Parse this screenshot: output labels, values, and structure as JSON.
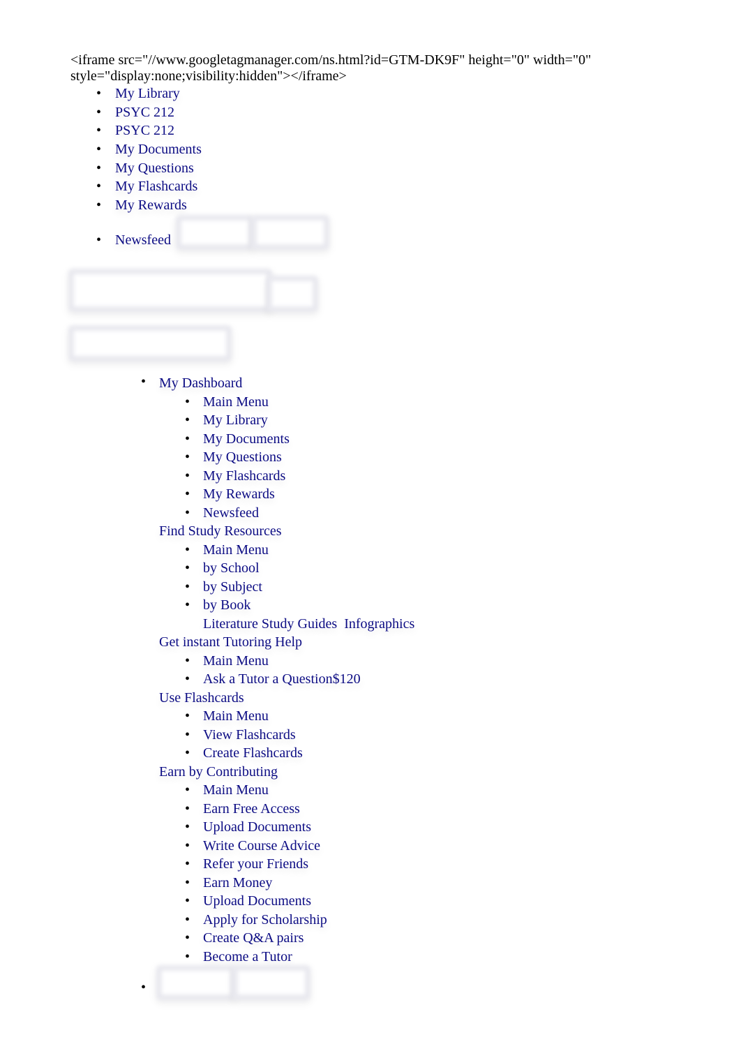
{
  "noscript_text": "<iframe src=\"//www.googletagmanager.com/ns.html?id=GTM-DK9F\" height=\"0\" width=\"0\" style=\"display:none;visibility:hidden\"></iframe>",
  "top_nav": {
    "items": [
      {
        "label": "My Library"
      },
      {
        "label": "PSYC 212"
      },
      {
        "label": "PSYC 212"
      },
      {
        "label": "My Documents"
      },
      {
        "label": "My Questions"
      },
      {
        "label": "My Flashcards"
      },
      {
        "label": "My Rewards"
      }
    ],
    "newsfeed_label": "Newsfeed"
  },
  "main_nav": {
    "dashboard": {
      "label": "My Dashboard",
      "items": [
        {
          "label": "Main Menu"
        },
        {
          "label": "My Library"
        },
        {
          "label": "My Documents"
        },
        {
          "label": "My Questions"
        },
        {
          "label": "My Flashcards"
        },
        {
          "label": "My Rewards"
        },
        {
          "label": "Newsfeed"
        }
      ]
    },
    "study_resources": {
      "label": "Find Study Resources",
      "items": [
        {
          "label": "Main Menu"
        },
        {
          "label": "by School"
        },
        {
          "label": "by Subject"
        },
        {
          "label": "by Book"
        }
      ],
      "extra_links": [
        "Literature Study Guides",
        "Infographics"
      ]
    },
    "tutoring": {
      "label": "Get instant Tutoring Help",
      "items": [
        {
          "label": "Main Menu"
        },
        {
          "label": "Ask a Tutor a Question$120"
        }
      ]
    },
    "flashcards": {
      "label": "Use Flashcards",
      "items": [
        {
          "label": "Main Menu"
        },
        {
          "label": "View Flashcards"
        },
        {
          "label": "Create Flashcards"
        }
      ]
    },
    "contributing": {
      "label": "Earn by Contributing",
      "items": [
        {
          "label": "Main Menu"
        },
        {
          "label": "Earn Free Access"
        },
        {
          "label": "Upload Documents"
        },
        {
          "label": "Write Course Advice"
        },
        {
          "label": "Refer your Friends"
        },
        {
          "label": "Earn Money"
        },
        {
          "label": "Upload Documents"
        },
        {
          "label": "Apply for Scholarship"
        },
        {
          "label": "Create Q&A pairs"
        },
        {
          "label": "Become a Tutor"
        }
      ]
    }
  },
  "colors": {
    "link": "#0c0c84",
    "text": "#000000",
    "placeholder_border": "#e9e9ef"
  }
}
